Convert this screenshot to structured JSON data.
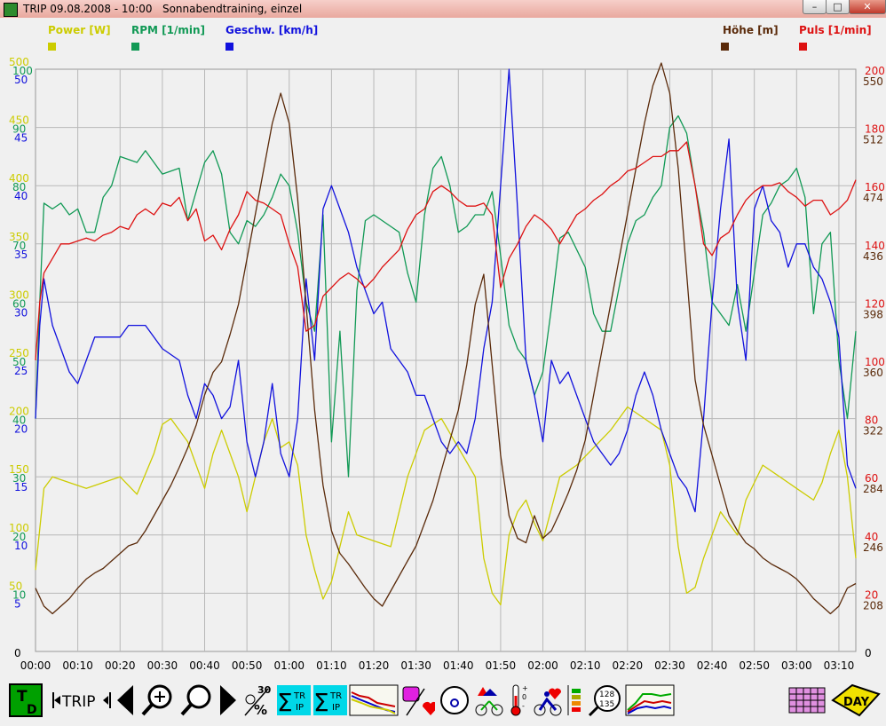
{
  "window": {
    "title": "TRIP 09.08.2008 - 10:00   Sonnabendtraining, einzel",
    "buttons": [
      "–",
      "□",
      "✕"
    ]
  },
  "legend": [
    {
      "label": "Power [W]",
      "color": "#cccc00"
    },
    {
      "label": "RPM [1/min]",
      "color": "#119955"
    },
    {
      "label": "Geschw. [km/h]",
      "color": "#1111dd"
    },
    {
      "label": "Höhe [m]",
      "color": "#5a2a0a"
    },
    {
      "label": "Puls [1/min]",
      "color": "#dd1111"
    }
  ],
  "chart_data": {
    "type": "line",
    "x_ticks": [
      "00:00",
      "00:10",
      "00:20",
      "00:30",
      "00:40",
      "00:50",
      "01:00",
      "01:10",
      "01:20",
      "01:30",
      "01:40",
      "01:50",
      "02:00",
      "02:10",
      "02:20",
      "02:30",
      "02:40",
      "02:50",
      "03:00",
      "03:10"
    ],
    "axes": {
      "power": {
        "ticks": [
          "500",
          "450",
          "400",
          "350",
          "300",
          "250",
          "200",
          "150",
          "100",
          "50"
        ],
        "zero": "0",
        "color": "#cccc00"
      },
      "rpm": {
        "ticks": [
          "100",
          "90",
          "80",
          "70",
          "60",
          "50",
          "40",
          "30",
          "20",
          "10"
        ],
        "color": "#119955"
      },
      "speed": {
        "ticks": [
          "50",
          "45",
          "40",
          "35",
          "30",
          "25",
          "20",
          "15",
          "10",
          "5"
        ],
        "color": "#1111dd"
      },
      "pulse": {
        "ticks": [
          "200",
          "180",
          "160",
          "140",
          "120",
          "100",
          "80",
          "60",
          "40",
          "20"
        ],
        "zero": "0",
        "color": "#dd1111"
      },
      "height": {
        "ticks": [
          "550",
          "512",
          "474",
          "436",
          "398",
          "360",
          "322",
          "284",
          "246",
          "208"
        ],
        "bottom": "170",
        "color": "#5a2a0a"
      }
    },
    "x_range_min": [
      0,
      194
    ],
    "series": [
      {
        "name": "Power [W]",
        "color": "#cccc00",
        "x": [
          0,
          2,
          4,
          8,
          12,
          16,
          20,
          24,
          28,
          30,
          32,
          36,
          40,
          42,
          44,
          48,
          50,
          54,
          56,
          58,
          60,
          62,
          64,
          66,
          68,
          70,
          72,
          74,
          76,
          80,
          84,
          88,
          92,
          96,
          100,
          104,
          106,
          108,
          110,
          112,
          114,
          116,
          118,
          120,
          124,
          128,
          132,
          136,
          140,
          144,
          148,
          150,
          152,
          154,
          156,
          158,
          160,
          162,
          164,
          166,
          168,
          172,
          176,
          180,
          184,
          186,
          188,
          190,
          192,
          194
        ],
        "y": [
          70,
          140,
          150,
          145,
          140,
          145,
          150,
          135,
          170,
          195,
          200,
          180,
          140,
          170,
          190,
          150,
          120,
          180,
          200,
          175,
          180,
          160,
          100,
          70,
          45,
          60,
          90,
          120,
          100,
          95,
          90,
          150,
          190,
          200,
          175,
          150,
          80,
          50,
          40,
          100,
          120,
          130,
          110,
          95,
          150,
          160,
          175,
          190,
          210,
          200,
          190,
          160,
          90,
          50,
          55,
          80,
          100,
          120,
          110,
          100,
          130,
          160,
          150,
          140,
          130,
          145,
          170,
          190,
          150,
          80
        ]
      },
      {
        "name": "RPM [1/min]",
        "color": "#119955",
        "x": [
          0,
          1,
          2,
          4,
          6,
          8,
          10,
          12,
          14,
          16,
          18,
          20,
          24,
          26,
          30,
          34,
          36,
          40,
          42,
          44,
          46,
          48,
          50,
          52,
          54,
          56,
          58,
          60,
          62,
          64,
          66,
          68,
          70,
          72,
          74,
          76,
          78,
          80,
          84,
          86,
          88,
          90,
          92,
          94,
          96,
          98,
          100,
          102,
          104,
          106,
          108,
          110,
          112,
          114,
          116,
          118,
          120,
          122,
          124,
          126,
          130,
          132,
          134,
          136,
          140,
          142,
          144,
          146,
          148,
          150,
          152,
          154,
          156,
          158,
          160,
          162,
          164,
          166,
          168,
          170,
          172,
          174,
          176,
          178,
          180,
          182,
          184,
          186,
          188,
          190,
          192,
          194
        ],
        "y": [
          40,
          60,
          77,
          76,
          77,
          75,
          76,
          72,
          72,
          78,
          80,
          85,
          84,
          86,
          82,
          83,
          74,
          84,
          86,
          82,
          72,
          70,
          74,
          73,
          75,
          78,
          82,
          80,
          72,
          60,
          55,
          75,
          36,
          55,
          30,
          62,
          74,
          75,
          73,
          72,
          65,
          60,
          75,
          83,
          85,
          80,
          72,
          73,
          75,
          75,
          79,
          68,
          56,
          52,
          50,
          44,
          48,
          59,
          71,
          72,
          66,
          58,
          55,
          55,
          70,
          74,
          75,
          78,
          80,
          90,
          92,
          89,
          80,
          72,
          60,
          58,
          56,
          63,
          55,
          65,
          75,
          77,
          80,
          81,
          83,
          78,
          58,
          70,
          72,
          50,
          40,
          55
        ]
      },
      {
        "name": "Geschw. [km/h]",
        "color": "#1111dd",
        "x": [
          0,
          1,
          2,
          4,
          6,
          8,
          10,
          12,
          14,
          16,
          18,
          20,
          22,
          24,
          26,
          30,
          34,
          36,
          38,
          40,
          42,
          44,
          46,
          48,
          50,
          52,
          54,
          56,
          58,
          60,
          62,
          64,
          66,
          68,
          70,
          72,
          74,
          76,
          78,
          80,
          82,
          84,
          86,
          88,
          90,
          92,
          94,
          96,
          98,
          100,
          102,
          104,
          106,
          108,
          110,
          112,
          114,
          116,
          118,
          120,
          122,
          124,
          126,
          128,
          130,
          132,
          134,
          136,
          138,
          140,
          142,
          144,
          146,
          148,
          150,
          152,
          154,
          156,
          158,
          160,
          162,
          164,
          166,
          168,
          170,
          172,
          174,
          176,
          178,
          180,
          182,
          184,
          186,
          188,
          190,
          192,
          194
        ],
        "y": [
          20,
          28,
          32,
          28,
          26,
          24,
          23,
          25,
          27,
          27,
          27,
          27,
          28,
          28,
          28,
          26,
          25,
          22,
          20,
          23,
          22,
          20,
          21,
          25,
          18,
          15,
          18,
          23,
          17,
          15,
          20,
          32,
          25,
          38,
          40,
          38,
          36,
          33,
          31,
          29,
          30,
          26,
          25,
          24,
          22,
          22,
          20,
          18,
          17,
          18,
          17,
          20,
          26,
          30,
          40,
          50,
          38,
          25,
          22,
          18,
          25,
          23,
          24,
          22,
          20,
          18,
          17,
          16,
          17,
          19,
          22,
          24,
          22,
          19,
          17,
          15,
          14,
          12,
          20,
          30,
          38,
          44,
          30,
          25,
          38,
          40,
          37,
          36,
          33,
          35,
          35,
          33,
          32,
          30,
          27,
          16,
          14
        ]
      },
      {
        "name": "Höhe [m]",
        "color": "#5a2a0a",
        "x": [
          0,
          2,
          4,
          6,
          8,
          10,
          12,
          14,
          16,
          18,
          20,
          22,
          24,
          26,
          28,
          30,
          32,
          34,
          36,
          38,
          40,
          42,
          44,
          46,
          48,
          50,
          52,
          54,
          56,
          58,
          60,
          62,
          64,
          66,
          68,
          70,
          72,
          74,
          76,
          78,
          80,
          82,
          84,
          86,
          88,
          90,
          92,
          94,
          96,
          98,
          100,
          102,
          104,
          106,
          108,
          110,
          112,
          114,
          116,
          118,
          120,
          122,
          124,
          126,
          128,
          130,
          132,
          134,
          136,
          138,
          140,
          142,
          144,
          146,
          148,
          150,
          152,
          154,
          156,
          158,
          160,
          162,
          164,
          166,
          168,
          170,
          172,
          174,
          176,
          178,
          180,
          182,
          184,
          186,
          188,
          190,
          192,
          194
        ],
        "y": [
          212,
          200,
          195,
          200,
          205,
          212,
          218,
          222,
          225,
          230,
          235,
          240,
          242,
          250,
          260,
          270,
          280,
          292,
          305,
          320,
          340,
          355,
          362,
          380,
          400,
          430,
          460,
          490,
          520,
          540,
          520,
          470,
          400,
          330,
          280,
          250,
          235,
          228,
          220,
          212,
          205,
          200,
          210,
          220,
          230,
          240,
          255,
          270,
          290,
          310,
          330,
          360,
          400,
          420,
          360,
          300,
          260,
          245,
          242,
          260,
          245,
          250,
          262,
          275,
          290,
          310,
          340,
          370,
          400,
          430,
          460,
          490,
          520,
          545,
          560,
          540,
          490,
          420,
          350,
          320,
          300,
          280,
          260,
          250,
          242,
          238,
          232,
          228,
          225,
          222,
          218,
          212,
          205,
          200,
          195,
          200,
          212,
          215
        ]
      },
      {
        "name": "Puls [1/min]",
        "color": "#dd1111",
        "x": [
          0,
          1,
          2,
          4,
          6,
          8,
          10,
          12,
          14,
          16,
          18,
          20,
          22,
          24,
          26,
          28,
          30,
          32,
          34,
          36,
          38,
          40,
          42,
          44,
          46,
          48,
          50,
          52,
          54,
          56,
          58,
          60,
          62,
          64,
          66,
          68,
          70,
          72,
          74,
          76,
          78,
          80,
          82,
          84,
          86,
          88,
          90,
          92,
          94,
          96,
          98,
          100,
          102,
          104,
          106,
          108,
          110,
          112,
          114,
          116,
          118,
          120,
          122,
          124,
          126,
          128,
          130,
          132,
          134,
          136,
          138,
          140,
          142,
          144,
          146,
          148,
          150,
          152,
          154,
          156,
          158,
          160,
          162,
          164,
          166,
          168,
          170,
          172,
          174,
          176,
          178,
          180,
          182,
          184,
          186,
          188,
          190,
          192,
          194
        ],
        "y": [
          100,
          120,
          130,
          135,
          140,
          140,
          141,
          142,
          141,
          143,
          144,
          146,
          145,
          150,
          152,
          150,
          154,
          153,
          156,
          148,
          152,
          141,
          143,
          138,
          145,
          150,
          158,
          155,
          154,
          152,
          150,
          140,
          132,
          110,
          112,
          122,
          125,
          128,
          130,
          128,
          125,
          128,
          132,
          135,
          138,
          145,
          150,
          152,
          158,
          160,
          158,
          155,
          153,
          153,
          154,
          150,
          125,
          135,
          140,
          146,
          150,
          148,
          145,
          140,
          145,
          150,
          152,
          155,
          157,
          160,
          162,
          165,
          166,
          168,
          170,
          170,
          172,
          172,
          175,
          160,
          140,
          136,
          142,
          144,
          150,
          155,
          158,
          160,
          160,
          161,
          158,
          156,
          153,
          155,
          155,
          150,
          152,
          155,
          162
        ]
      }
    ]
  },
  "toolbar": {
    "td_label": "T D",
    "trip_label": "TRIP",
    "sum_trip_label": "TR IP",
    "sum_trip2_label": "TR IP",
    "gauge_values": [
      "128",
      "135"
    ],
    "num_30": "30",
    "percent": "%",
    "day_label": "DAY",
    "thermo_plus": "+",
    "thermo_zero": "0",
    "thermo_minus": "-"
  }
}
